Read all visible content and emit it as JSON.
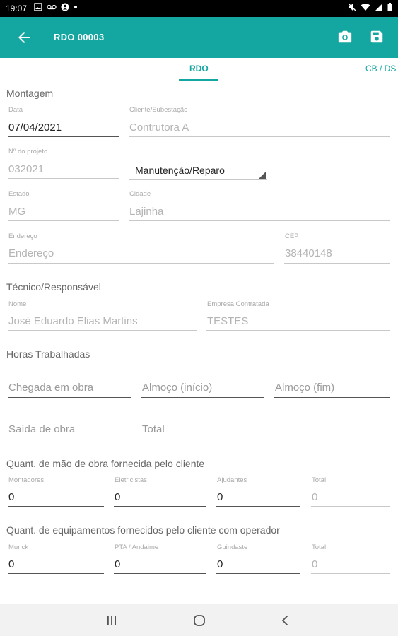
{
  "status_bar": {
    "time": "19:07",
    "left_icons": [
      "image-icon",
      "voicemail-icon",
      "account-circle-icon",
      "dot-icon"
    ],
    "right_icons": [
      "mute-icon",
      "wifi-icon",
      "signal-icon",
      "battery-icon"
    ]
  },
  "app_bar": {
    "title": "RDO 00003",
    "accent_color": "#14a6a0"
  },
  "tabs": [
    {
      "label": "RDO",
      "selected": true
    },
    {
      "label": "CB / DS",
      "selected": false
    }
  ],
  "montagem": {
    "heading": "Montagem",
    "data_label": "Data",
    "data_value": "07/04/2021",
    "cliente_label": "Cliente/Subestação",
    "cliente_value": "Contrutora A",
    "projeto_label": "Nº do projeto",
    "projeto_value": "032021",
    "tipo_value": "Manutenção/Reparo",
    "estado_label": "Estado",
    "estado_value": "MG",
    "cidade_label": "Cidade",
    "cidade_value": "Lajinha",
    "endereco_label": "Endereço",
    "endereco_value": "Endereço",
    "cep_label": "CEP",
    "cep_value": "38440148"
  },
  "tecnico": {
    "heading": "Técnico/Responsável",
    "nome_label": "Nome",
    "nome_value": "José Eduardo Elias Martins",
    "empresa_label": "Empresa Contratada",
    "empresa_value": "TESTES"
  },
  "horas": {
    "heading": "Horas Trabalhadas",
    "chegada_placeholder": "Chegada em obra",
    "almoco_inicio_placeholder": "Almoço (início)",
    "almoco_fim_placeholder": "Almoço (fim)",
    "saida_placeholder": "Saída de obra",
    "total_placeholder": "Total"
  },
  "mao_obra": {
    "heading": "Quant. de mão de obra fornecida pelo cliente",
    "fields": [
      {
        "label": "Montadores",
        "value": "0"
      },
      {
        "label": "Eletricistas",
        "value": "0"
      },
      {
        "label": "Ajudantes",
        "value": "0"
      },
      {
        "label": "Total",
        "value": "0"
      }
    ]
  },
  "equipamentos": {
    "heading": "Quant. de equipamentos fornecidos pelo cliente com operador",
    "fields": [
      {
        "label": "Munck",
        "value": "0"
      },
      {
        "label": "PTA / Andaime",
        "value": "0"
      },
      {
        "label": "Guindaste",
        "value": "0"
      },
      {
        "label": "Total",
        "value": "0"
      }
    ]
  },
  "nav_bar": {
    "buttons": [
      "recents-icon",
      "home-icon",
      "back-nav-icon"
    ]
  }
}
